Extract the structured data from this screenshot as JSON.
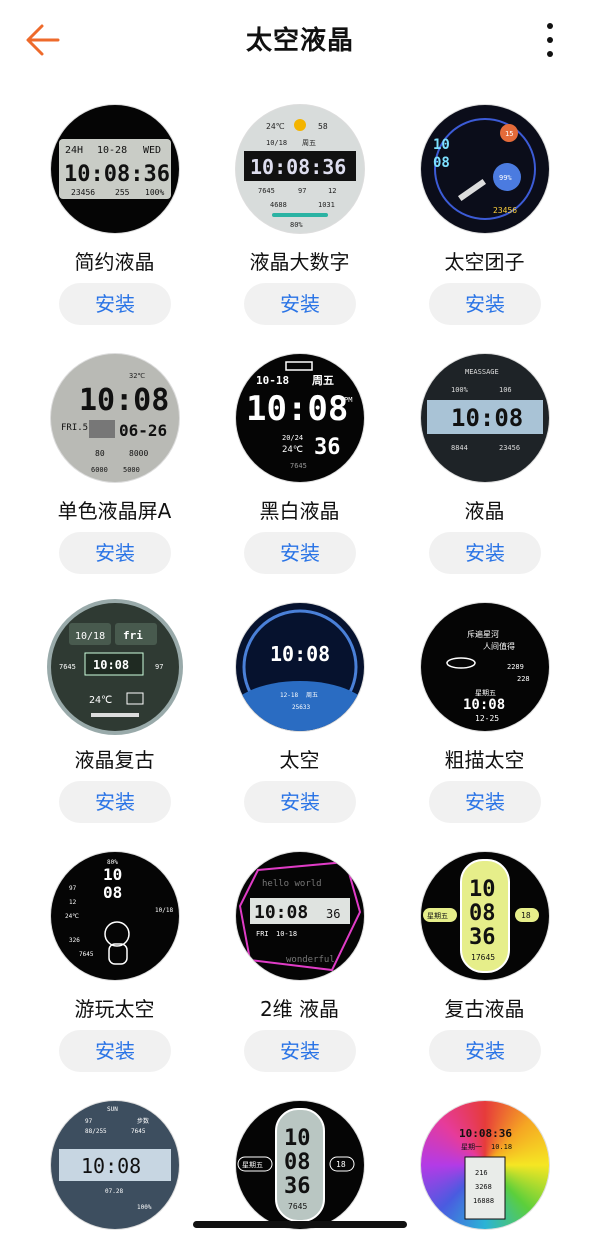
{
  "header": {
    "title": "太空液晶"
  },
  "install_label": "安装",
  "colors": {
    "accent": "#2a74e6",
    "back": "#ee6a2b"
  },
  "faces": [
    {
      "name": "简约液晶",
      "texts": [
        "24H",
        "10-28",
        "WED",
        "10:08:36",
        "23456",
        "255",
        "100%"
      ]
    },
    {
      "name": "液晶大数字",
      "texts": [
        "24℃",
        "58",
        "10/18",
        "周五",
        "10:08:36",
        "7645",
        "97",
        "12",
        "4688",
        "1031",
        "80%"
      ]
    },
    {
      "name": "太空团子",
      "texts": [
        "10",
        "08",
        "15",
        "99%",
        "23456"
      ]
    },
    {
      "name": "单色液晶屏A",
      "texts": [
        "32℃",
        "10:08",
        "FRI.5",
        "06-26",
        "80",
        "8000",
        "6000",
        "5000"
      ]
    },
    {
      "name": "黑白液晶",
      "texts": [
        "10-18",
        "周五",
        "10:08",
        "PM",
        "20/24",
        "24℃",
        "36",
        "7645"
      ]
    },
    {
      "name": "液晶",
      "texts": [
        "MEASSAGE",
        "100%",
        "106",
        "10:08",
        "8844",
        "23456"
      ]
    },
    {
      "name": "液晶复古",
      "texts": [
        "10/18",
        "fri",
        "10:08",
        "7645",
        "97",
        "24℃"
      ]
    },
    {
      "name": "太空",
      "texts": [
        "10:08",
        "12-18",
        "周五",
        "25633"
      ]
    },
    {
      "name": "粗描太空",
      "texts": [
        "斥遍星河",
        "人间值得",
        "2289",
        "228",
        "星期五",
        "10:08",
        "12-25"
      ]
    },
    {
      "name": "游玩太空",
      "texts": [
        "80%",
        "10",
        "08",
        "97",
        "12",
        "24℃",
        "10/18",
        "326",
        "7645"
      ]
    },
    {
      "name": "2维 液晶",
      "texts": [
        "hello world",
        "10:08",
        "36",
        "FRI",
        "10-18",
        "wonderful"
      ]
    },
    {
      "name": "复古液晶",
      "texts": [
        "10",
        "08",
        "36",
        "星期五",
        "18",
        "17645"
      ]
    },
    {
      "name": "",
      "texts": [
        "SUN",
        "97",
        "88/255",
        "步数",
        "7645",
        "10:08",
        "07.28",
        "100%"
      ]
    },
    {
      "name": "",
      "texts": [
        "10",
        "08",
        "36",
        "星期五",
        "18",
        "7645"
      ]
    },
    {
      "name": "",
      "texts": [
        "10:08:36",
        "星期一",
        "10.18",
        "216",
        "3268",
        "16888"
      ]
    }
  ]
}
